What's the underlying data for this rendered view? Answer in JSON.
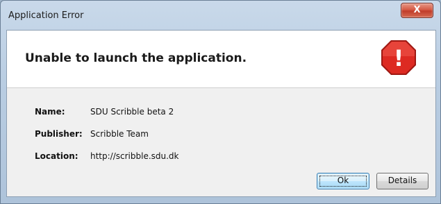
{
  "window": {
    "title": "Application Error",
    "close_symbol": "X"
  },
  "dialog": {
    "heading": "Unable to launch the application.",
    "icon": "error-stop-sign-icon",
    "icon_symbol": "!",
    "colors": {
      "icon": "#d9251f",
      "close": "#c8473a"
    }
  },
  "info": [
    {
      "label": "Name:",
      "value": "SDU Scribble beta 2"
    },
    {
      "label": "Publisher:",
      "value": "Scribble Team"
    },
    {
      "label": "Location:",
      "value": "http://scribble.sdu.dk"
    }
  ],
  "buttons": {
    "ok": "Ok",
    "details": "Details"
  }
}
